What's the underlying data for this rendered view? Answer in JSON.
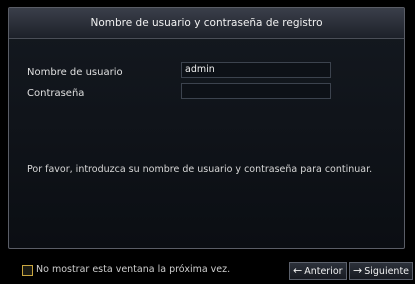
{
  "dialog": {
    "title": "Nombre de usuario y contraseña de registro",
    "username_label": "Nombre de usuario",
    "username_value": "admin",
    "password_label": "Contraseña",
    "password_value": "",
    "message": "Por favor, introduzca su nombre de usuario y contraseña para continuar."
  },
  "footer": {
    "checkbox_label": "No mostrar esta ventana la próxima vez.",
    "checkbox_checked": false,
    "prev_arrow": "←",
    "prev_label": "Anterior",
    "next_arrow": "→",
    "next_label": "Siguiente"
  },
  "colors": {
    "accent_border": "#c9a640",
    "title_bar": "#2f343e"
  }
}
